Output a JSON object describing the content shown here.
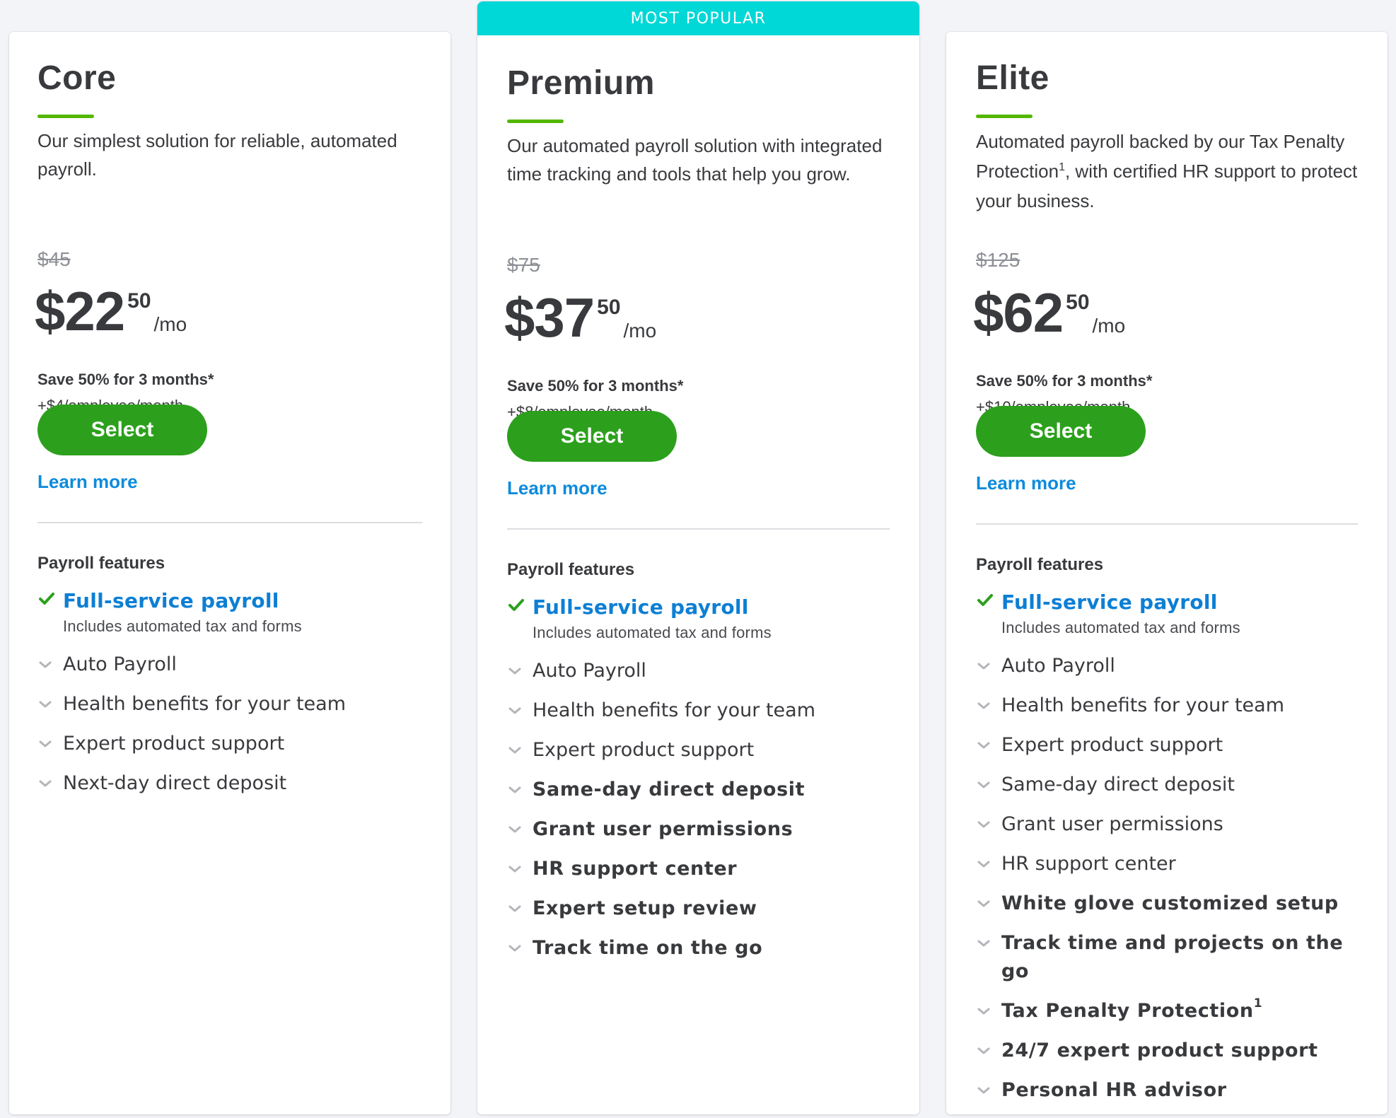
{
  "colors": {
    "page_background": "#f3f4f7",
    "badge": "#00d7d7",
    "accent_green": "#53b700",
    "button_green": "#2ca01c",
    "link_blue": "#0d8bdc",
    "check_green": "#2ca01c",
    "chevron_gray": "#b3b5ba"
  },
  "plans": [
    {
      "name": "Core",
      "badge": null,
      "description": "Our simplest solution for reliable, automated payroll.",
      "description_sup": "",
      "description_tail": "",
      "old_price": "$45",
      "price_dollars": "$22",
      "price_cents": "50",
      "price_period": "/mo",
      "promo": "Save 50% for 3 months*",
      "per_employee": "+$4/employee/month",
      "select_label": "Select",
      "learn_more_label": "Learn more",
      "section_title": "Payroll features",
      "highlight_feature": {
        "icon": "check-icon",
        "label": "Full-service payroll",
        "sublabel": "Includes automated tax and forms"
      },
      "features": [
        {
          "label": "Auto Payroll",
          "sup": "",
          "emphasized": false,
          "icon": "chevron-down-icon"
        },
        {
          "label": "Health benefits for your team",
          "sup": "",
          "emphasized": false,
          "icon": "chevron-down-icon"
        },
        {
          "label": "Expert product support",
          "sup": "",
          "emphasized": false,
          "icon": "chevron-down-icon"
        },
        {
          "label": "Next-day direct deposit",
          "sup": "",
          "emphasized": false,
          "icon": "chevron-down-icon"
        }
      ]
    },
    {
      "name": "Premium",
      "badge": "MOST POPULAR",
      "description": "Our automated payroll solution with integrated time tracking and tools that help you grow.",
      "description_sup": "",
      "description_tail": "",
      "old_price": "$75",
      "price_dollars": "$37",
      "price_cents": "50",
      "price_period": "/mo",
      "promo": "Save 50% for 3 months*",
      "per_employee": "+$8/employee/month",
      "select_label": "Select",
      "learn_more_label": "Learn more",
      "section_title": "Payroll features",
      "highlight_feature": {
        "icon": "check-icon",
        "label": "Full-service payroll",
        "sublabel": "Includes automated tax and forms"
      },
      "features": [
        {
          "label": "Auto Payroll",
          "sup": "",
          "emphasized": false,
          "icon": "chevron-down-icon"
        },
        {
          "label": "Health benefits for your team",
          "sup": "",
          "emphasized": false,
          "icon": "chevron-down-icon"
        },
        {
          "label": "Expert product support",
          "sup": "",
          "emphasized": false,
          "icon": "chevron-down-icon"
        },
        {
          "label": "Same-day direct deposit",
          "sup": "",
          "emphasized": true,
          "icon": "chevron-down-icon"
        },
        {
          "label": "Grant user permissions",
          "sup": "",
          "emphasized": true,
          "icon": "chevron-down-icon"
        },
        {
          "label": "HR support center",
          "sup": "",
          "emphasized": true,
          "icon": "chevron-down-icon"
        },
        {
          "label": "Expert setup review",
          "sup": "",
          "emphasized": true,
          "icon": "chevron-down-icon"
        },
        {
          "label": "Track time on the go",
          "sup": "",
          "emphasized": true,
          "icon": "chevron-down-icon"
        }
      ]
    },
    {
      "name": "Elite",
      "badge": null,
      "description": "Automated payroll backed by our Tax Penalty Protection",
      "description_sup": "1",
      "description_tail": ", with certified HR support to protect your business.",
      "old_price": "$125",
      "price_dollars": "$62",
      "price_cents": "50",
      "price_period": "/mo",
      "promo": "Save 50% for 3 months*",
      "per_employee": "+$10/employee/month",
      "select_label": "Select",
      "learn_more_label": "Learn more",
      "section_title": "Payroll features",
      "highlight_feature": {
        "icon": "check-icon",
        "label": "Full-service payroll",
        "sublabel": "Includes automated tax and forms"
      },
      "features": [
        {
          "label": "Auto Payroll",
          "sup": "",
          "emphasized": false,
          "icon": "chevron-down-icon"
        },
        {
          "label": "Health benefits for your team",
          "sup": "",
          "emphasized": false,
          "icon": "chevron-down-icon"
        },
        {
          "label": "Expert product support",
          "sup": "",
          "emphasized": false,
          "icon": "chevron-down-icon"
        },
        {
          "label": "Same-day direct deposit",
          "sup": "",
          "emphasized": false,
          "icon": "chevron-down-icon"
        },
        {
          "label": "Grant user permissions",
          "sup": "",
          "emphasized": false,
          "icon": "chevron-down-icon"
        },
        {
          "label": "HR support center",
          "sup": "",
          "emphasized": false,
          "icon": "chevron-down-icon"
        },
        {
          "label": "White glove customized setup",
          "sup": "",
          "emphasized": true,
          "icon": "chevron-down-icon"
        },
        {
          "label": "Track time and projects on the go",
          "sup": "",
          "emphasized": true,
          "icon": "chevron-down-icon"
        },
        {
          "label": "Tax Penalty Protection",
          "sup": "1",
          "emphasized": true,
          "icon": "chevron-down-icon"
        },
        {
          "label": "24/7 expert product support",
          "sup": "",
          "emphasized": true,
          "icon": "chevron-down-icon"
        },
        {
          "label": "Personal HR advisor",
          "sup": "",
          "emphasized": true,
          "icon": "chevron-down-icon"
        }
      ]
    }
  ]
}
